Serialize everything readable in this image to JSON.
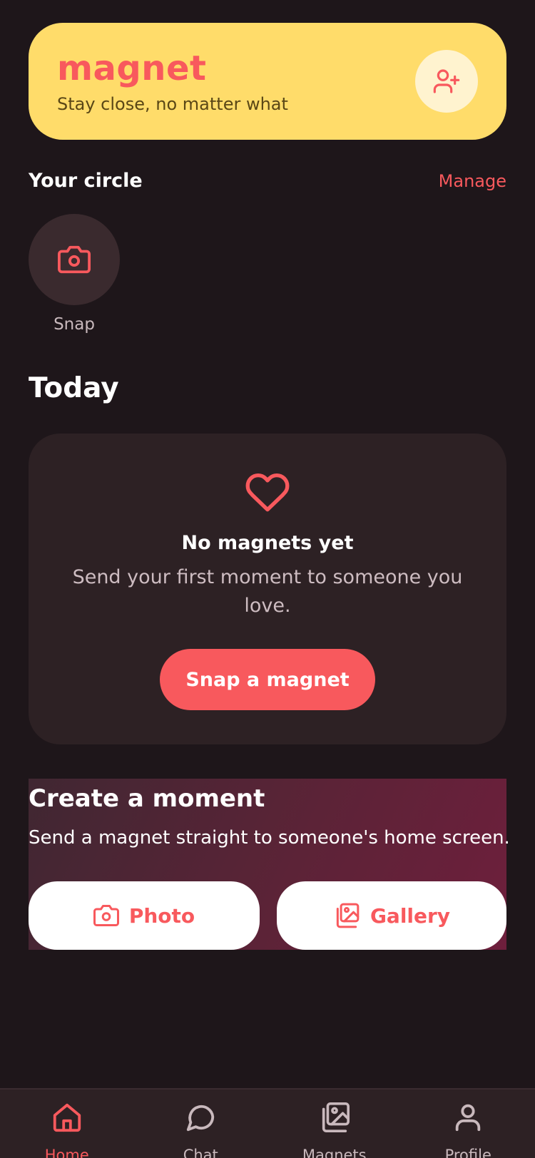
{
  "header": {
    "brand": "magnet",
    "tagline": "Stay close, no matter what",
    "add_friend_icon": "user-plus-icon"
  },
  "circle": {
    "title": "Your circle",
    "manage_label": "Manage",
    "members": [
      {
        "label": "Snap",
        "icon": "camera-icon"
      }
    ]
  },
  "today": {
    "title": "Today",
    "empty": {
      "icon": "heart-icon",
      "title": "No magnets yet",
      "text": "Send your first moment to someone you love.",
      "button_label": "Snap a magnet"
    }
  },
  "moment": {
    "title": "Create a moment",
    "text": "Send a magnet straight to someone's home screen.",
    "photo_label": "Photo",
    "gallery_label": "Gallery"
  },
  "nav": {
    "items": [
      {
        "label": "Home",
        "icon": "home-icon",
        "active": true
      },
      {
        "label": "Chat",
        "icon": "chat-bubble-icon",
        "active": false
      },
      {
        "label": "Magnets",
        "icon": "images-icon",
        "active": false
      },
      {
        "label": "Profile",
        "icon": "user-icon",
        "active": false
      }
    ]
  },
  "colors": {
    "background": "#1e161a",
    "accent": "#f8595d",
    "header": "#ffdc6a",
    "card": "#2d2124"
  }
}
